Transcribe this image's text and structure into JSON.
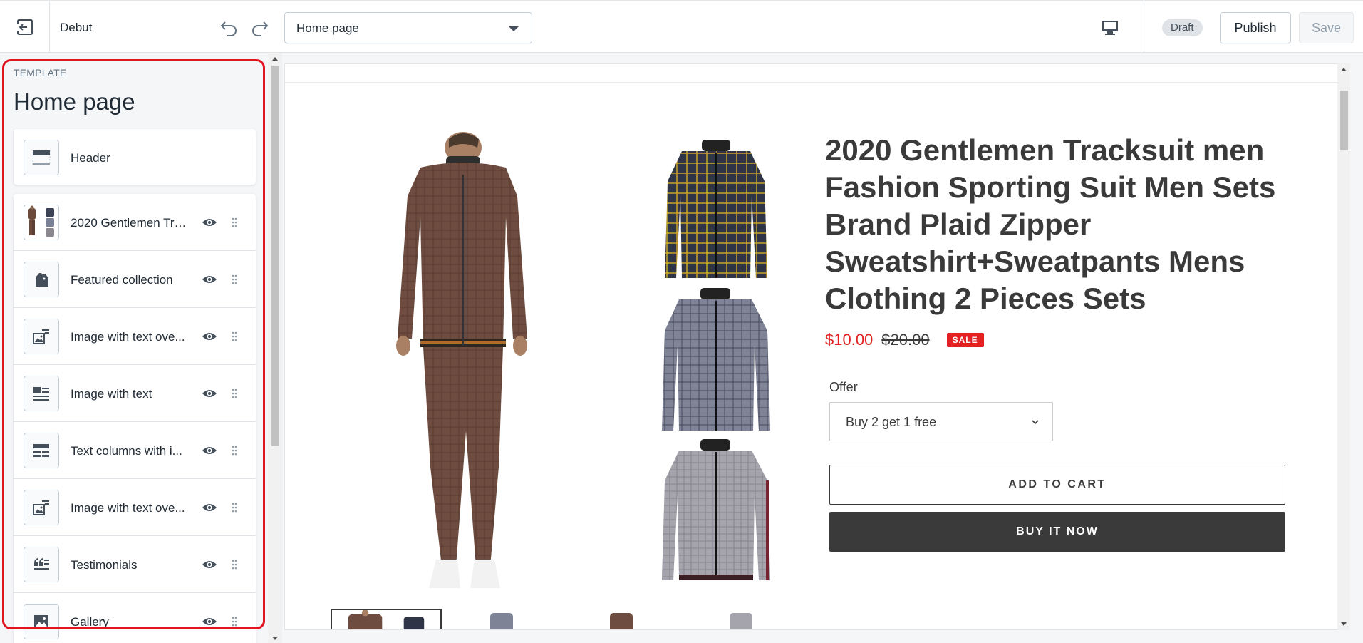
{
  "topbar": {
    "theme_name": "Debut",
    "page_selector_value": "Home page",
    "draft_badge": "Draft",
    "publish_label": "Publish",
    "save_label": "Save"
  },
  "sidebar": {
    "template_label": "TEMPLATE",
    "template_title": "Home page",
    "header_label": "Header",
    "sections": [
      {
        "label": "2020 Gentlemen Tra...",
        "icon": "product-thumbnail"
      },
      {
        "label": "Featured collection",
        "icon": "tag-icon"
      },
      {
        "label": "Image with text ove...",
        "icon": "image-text-icon"
      },
      {
        "label": "Image with text",
        "icon": "image-text-lines-icon"
      },
      {
        "label": "Text columns with i...",
        "icon": "columns-icon"
      },
      {
        "label": "Image with text ove...",
        "icon": "image-text-icon"
      },
      {
        "label": "Testimonials",
        "icon": "quote-icon"
      },
      {
        "label": "Gallery",
        "icon": "image-icon"
      }
    ]
  },
  "preview": {
    "product_title": "2020 Gentlemen Tracksuit men Fashion Sporting Suit Men Sets Brand Plaid Zipper Sweatshirt+Sweatpants Mens Clothing 2 Pieces Sets",
    "price_sale": "$10.00",
    "price_original": "$20.00",
    "sale_badge": "SALE",
    "offer_label": "Offer",
    "offer_value": "Buy 2 get 1 free",
    "add_to_cart": "ADD TO CART",
    "buy_it_now": "BUY IT NOW"
  },
  "colors": {
    "accent_red": "#e22120",
    "highlight_red": "#e3141f",
    "dark_button": "#3a3a3a"
  }
}
